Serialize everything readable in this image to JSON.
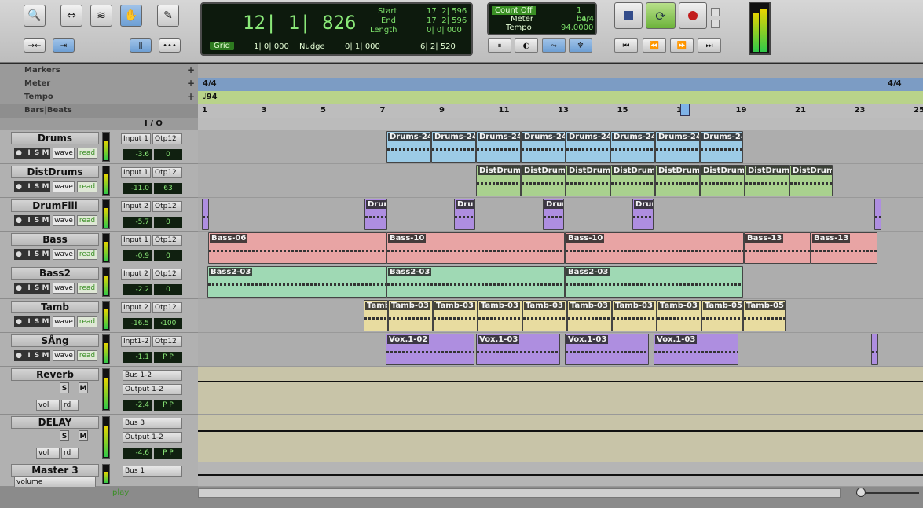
{
  "counter": {
    "main": "12| 1| 826",
    "start_label": "Start",
    "end_label": "End",
    "length_label": "Length",
    "start": "17| 2| 596",
    "end": "17| 2| 596",
    "length": "0| 0| 000",
    "grid_label": "Grid",
    "grid_value": "1| 0| 000",
    "nudge_label": "Nudge",
    "nudge_value": "0| 1| 000",
    "cursor_value": "6| 2| 520"
  },
  "mini": {
    "count_off": "Count Off",
    "bar": "1 bar",
    "meter_label": "Meter",
    "meter_value": "4/4",
    "tempo_label": "Tempo",
    "tempo_value": "94.0000"
  },
  "rulers": {
    "markers": "Markers",
    "meter": "Meter",
    "tempo": "Tempo",
    "bars": "Bars|Beats",
    "meter_mark": "4/4",
    "meter_mark2": "4/4",
    "tempo_mark": "94",
    "bar_numbers": [
      "1",
      "3",
      "5",
      "7",
      "9",
      "11",
      "13",
      "15",
      "17",
      "19",
      "21",
      "23",
      "25"
    ],
    "io": "I / O"
  },
  "tracks": [
    {
      "name": "Drums",
      "in": "Input 1",
      "out": "Otp12",
      "vol": "-3.6",
      "pan": "0",
      "read": "read",
      "wave": "wave",
      "clips": [
        {
          "n": "Drums-24",
          "l": 240,
          "w": 57
        },
        {
          "n": "Drums-24",
          "l": 297,
          "w": 57
        },
        {
          "n": "Drums-24",
          "l": 354,
          "w": 57
        },
        {
          "n": "Drums-24",
          "l": 411,
          "w": 57
        },
        {
          "n": "Drums-24",
          "l": 468,
          "w": 57
        },
        {
          "n": "Drums-24",
          "l": 525,
          "w": 57
        },
        {
          "n": "Drums-24",
          "l": 582,
          "w": 57
        },
        {
          "n": "Drums-24",
          "l": 639,
          "w": 55
        }
      ],
      "color": "blue"
    },
    {
      "name": "DistDrums",
      "in": "Input 1",
      "out": "Otp12",
      "vol": "-11.0",
      "pan": "63",
      "read": "read",
      "wave": "wave",
      "clips": [
        {
          "n": "DistDrums",
          "l": 354,
          "w": 57
        },
        {
          "n": "DistDrums",
          "l": 411,
          "w": 57
        },
        {
          "n": "DistDrums",
          "l": 468,
          "w": 57
        },
        {
          "n": "DistDrums",
          "l": 525,
          "w": 57
        },
        {
          "n": "DistDrums",
          "l": 582,
          "w": 57
        },
        {
          "n": "DistDrums",
          "l": 639,
          "w": 57
        },
        {
          "n": "DistDrums",
          "l": 696,
          "w": 57
        },
        {
          "n": "DistDrums",
          "l": 753,
          "w": 55
        }
      ],
      "color": "green"
    },
    {
      "name": "DrumFill",
      "in": "Input 2",
      "out": "Otp12",
      "vol": "-5.7",
      "pan": "0",
      "read": "read",
      "wave": "wave",
      "clips": [
        {
          "n": "",
          "l": 5,
          "w": 9
        },
        {
          "n": "Drum",
          "l": 212,
          "w": 29
        },
        {
          "n": "Drum",
          "l": 326,
          "w": 27
        },
        {
          "n": "Drum",
          "l": 439,
          "w": 27
        },
        {
          "n": "Drum",
          "l": 553,
          "w": 27
        },
        {
          "n": "",
          "l": 861,
          "w": 9
        }
      ],
      "color": "purple"
    },
    {
      "name": "Bass",
      "in": "Input 1",
      "out": "Otp12",
      "vol": "-0.9",
      "pan": "0",
      "read": "read",
      "wave": "wave",
      "clips": [
        {
          "n": "Bass-06",
          "l": 13,
          "w": 227
        },
        {
          "n": "Bass-10",
          "l": 240,
          "w": 227
        },
        {
          "n": "Bass-10",
          "l": 467,
          "w": 228
        },
        {
          "n": "Bass-13",
          "l": 695,
          "w": 85
        },
        {
          "n": "Bass-13",
          "l": 780,
          "w": 85
        }
      ],
      "color": "red"
    },
    {
      "name": "Bass2",
      "in": "Input 2",
      "out": "Otp12",
      "vol": "-2.2",
      "pan": "0",
      "read": "read",
      "wave": "wave",
      "clips": [
        {
          "n": "Bass2-03",
          "l": 12,
          "w": 228
        },
        {
          "n": "Bass2-03",
          "l": 240,
          "w": 227
        },
        {
          "n": "Bass2-03",
          "l": 467,
          "w": 227
        }
      ],
      "color": "teal"
    },
    {
      "name": "Tamb",
      "in": "Input 2",
      "out": "Otp12",
      "vol": "-16.5",
      "pan": "‹100",
      "read": "read",
      "wave": "wave",
      "clips": [
        {
          "n": "Tamb",
          "l": 211,
          "w": 31
        },
        {
          "n": "Tamb-03",
          "l": 242,
          "w": 57
        },
        {
          "n": "Tamb-03",
          "l": 299,
          "w": 57
        },
        {
          "n": "Tamb-03",
          "l": 356,
          "w": 57
        },
        {
          "n": "Tamb-03",
          "l": 413,
          "w": 57
        },
        {
          "n": "Tamb-03",
          "l": 470,
          "w": 57
        },
        {
          "n": "Tamb-03",
          "l": 527,
          "w": 57
        },
        {
          "n": "Tamb-03",
          "l": 584,
          "w": 57
        },
        {
          "n": "Tamb-05",
          "l": 641,
          "w": 53
        },
        {
          "n": "Tamb-05",
          "l": 694,
          "w": 54
        }
      ],
      "color": "tan"
    },
    {
      "name": "SÅng",
      "in": "Inpt1-2",
      "out": "Otp12",
      "vol": "-1.1",
      "pan": "P   P",
      "read": "read",
      "wave": "wave",
      "clips": [
        {
          "n": "Vox.1-02",
          "l": 239,
          "w": 113
        },
        {
          "n": "Vox.1-03",
          "l": 354,
          "w": 107
        },
        {
          "n": "Vox.1-03",
          "l": 467,
          "w": 107
        },
        {
          "n": "Vox.1-03",
          "l": 580,
          "w": 108
        },
        {
          "n": "",
          "l": 857,
          "w": 9
        }
      ],
      "color": "purple"
    }
  ],
  "aux": [
    {
      "name": "Reverb",
      "in": "Bus 1-2",
      "out": "Output 1-2",
      "vol": "-2.4",
      "pan": "P   P",
      "auto": "vol",
      "rd": "rd"
    },
    {
      "name": "DELAY",
      "in": "Bus 3",
      "out": "Output 1-2",
      "vol": "-4.6",
      "pan": "P   P",
      "auto": "vol",
      "rd": "rd"
    },
    {
      "name": "Master 3",
      "in": "Bus 1",
      "auto": "volume"
    }
  ],
  "status": {
    "play": "play"
  }
}
